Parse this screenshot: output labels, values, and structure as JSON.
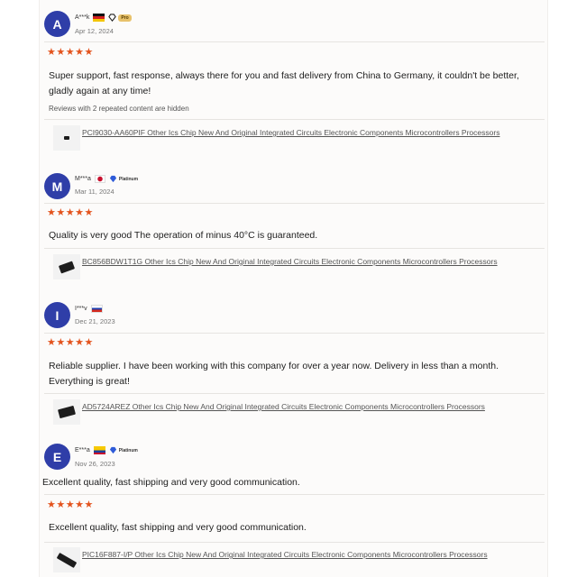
{
  "reviews": [
    {
      "avatar_letter": "A",
      "username": "A***k",
      "flag": "de",
      "badge": "pro",
      "badge_label": "Pro",
      "date": "Apr 12, 2024",
      "stars": "★★★★★",
      "text": "Super support, fast response, always there for you and fast delivery from China to Germany, it couldn't be better, gladly again at any time!",
      "note": "Reviews with 2 repeated content are hidden",
      "product": "PCI9030-AA60PIF Other Ics Chip New And Original Integrated Circuits Electronic Components Microcontrollers Processors",
      "product_thumb_icon": "small-chip-icon"
    },
    {
      "avatar_letter": "M",
      "username": "M***a",
      "flag": "jp",
      "badge": "platinum",
      "badge_label": "Platinum",
      "date": "Mar 11, 2024",
      "stars": "★★★★★",
      "text": "Quality is very good The operation of minus 40°C is guaranteed.",
      "product": "BC856BDW1T1G Other Ics Chip New And Original Integrated Circuits Electronic Components Microcontrollers Processors",
      "product_thumb_icon": "sot-chip-icon"
    },
    {
      "avatar_letter": "I",
      "username": "I***v",
      "flag": "ru",
      "date": "Dec 21, 2023",
      "stars": "★★★★★",
      "text": "Reliable supplier. I have been working with this company for over a year now. Delivery in less than a month. Everything is great!",
      "product": "AD5724AREZ Other Ics Chip New And Original Integrated Circuits Electronic Components Microcontrollers Processors",
      "product_thumb_icon": "soic-chip-icon"
    },
    {
      "avatar_letter": "E",
      "username": "E***a",
      "flag": "co",
      "badge": "platinum",
      "badge_label": "Platinum",
      "date": "Nov 26, 2023",
      "pre_text": "Excellent quality, fast shipping and very good communication.",
      "stars": "★★★★★",
      "text": "Excellent quality, fast shipping and very good communication.",
      "product": "PIC16F887-I/P Other Ics Chip New And Original Integrated Circuits Electronic Components Microcontrollers Processors",
      "product_thumb_icon": "dip-chip-icon"
    }
  ],
  "colors": {
    "avatar": "#2f3ea8",
    "stars": "#e3531d",
    "badge_gem": "#2f5bd8"
  }
}
